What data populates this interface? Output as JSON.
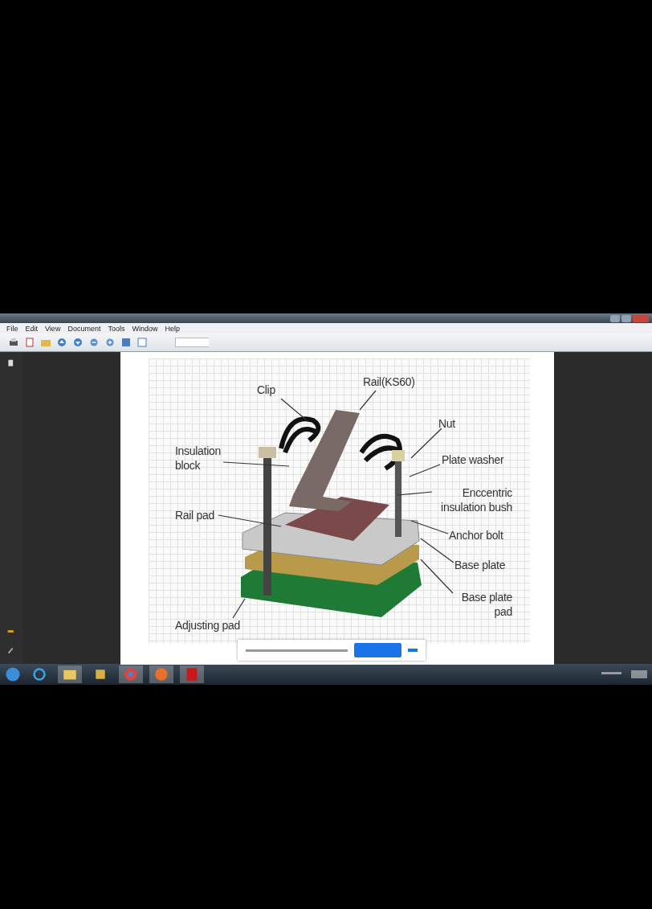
{
  "menu": [
    {
      "label": "File"
    },
    {
      "label": "Edit"
    },
    {
      "label": "View"
    },
    {
      "label": "Document"
    },
    {
      "label": "Tools"
    },
    {
      "label": "Window"
    },
    {
      "label": "Help"
    }
  ],
  "diagram": {
    "labels": [
      {
        "text": "Clip"
      },
      {
        "text": "Rail(KS60)"
      },
      {
        "text": "Nut"
      },
      {
        "text": "Insulation block"
      },
      {
        "text": "Plate washer"
      },
      {
        "text": "Enccentric insulation bush"
      },
      {
        "text": "Rail pad"
      },
      {
        "text": "Anchor bolt"
      },
      {
        "text": "Base plate"
      },
      {
        "text": "Base plate pad"
      },
      {
        "text": "Adjusting pad"
      }
    ]
  }
}
